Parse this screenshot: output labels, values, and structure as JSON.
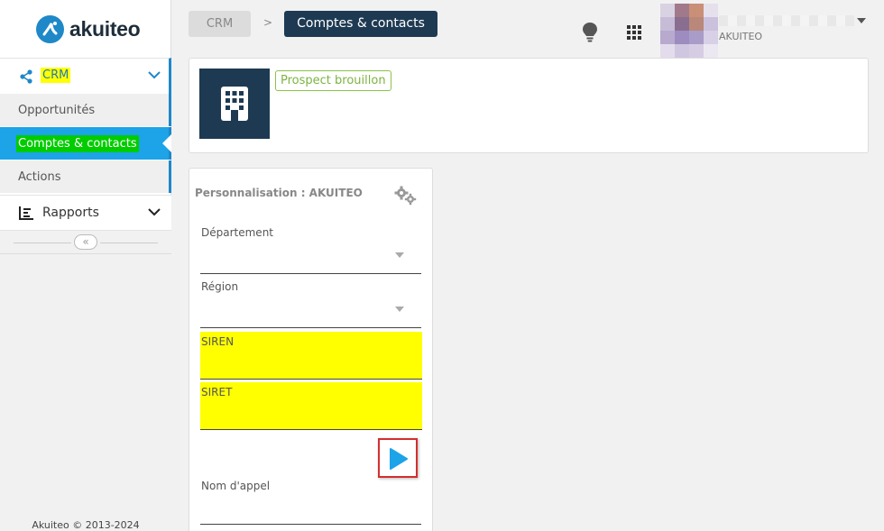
{
  "app": {
    "name": "akuiteo",
    "brand_color": "#1e88c9"
  },
  "sidebar": {
    "crm": {
      "label": "CRM",
      "icon": "share-icon"
    },
    "items": [
      {
        "label": "Opportunités"
      },
      {
        "label": "Comptes & contacts",
        "active": true
      },
      {
        "label": "Actions"
      }
    ],
    "rapports": {
      "label": "Rapports",
      "icon": "chart-icon"
    },
    "collapse": {
      "glyph": "«"
    },
    "copyright": "Akuiteo © 2013-2024"
  },
  "breadcrumb": {
    "root": "CRM",
    "separator": ">",
    "current": "Comptes & contacts"
  },
  "user": {
    "company": "AKUITEO"
  },
  "header": {
    "status_badge": "Prospect brouillon",
    "tile_icon": "building-icon"
  },
  "personalisation": {
    "title": "Personnalisation : AKUITEO",
    "fields": [
      {
        "label": "Département",
        "type": "select",
        "value": ""
      },
      {
        "label": "Région",
        "type": "select",
        "value": ""
      },
      {
        "label": "SIREN",
        "type": "text",
        "value": "",
        "highlight": "#ffff00"
      },
      {
        "label": "SIRET",
        "type": "text",
        "value": "",
        "highlight": "#ffff00"
      },
      {
        "label": "Nom d'appel",
        "type": "text",
        "value": ""
      }
    ]
  }
}
